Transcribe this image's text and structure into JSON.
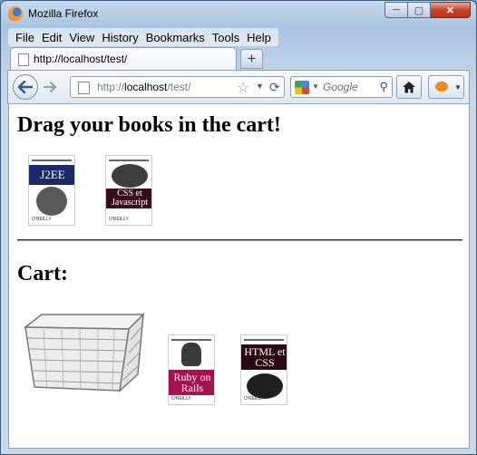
{
  "window": {
    "title": "Mozilla Firefox",
    "buttons": {
      "minimize": "─",
      "maximize": "▢",
      "close": "✕"
    }
  },
  "menubar": {
    "items": [
      "File",
      "Edit",
      "View",
      "History",
      "Bookmarks",
      "Tools",
      "Help"
    ]
  },
  "tab": {
    "label": "http://localhost/test/"
  },
  "newtab": {
    "label": "+"
  },
  "urlbar": {
    "prefix": "http://",
    "host": "localhost",
    "path": "/test/"
  },
  "search": {
    "placeholder": "Google"
  },
  "page": {
    "heading_drag": "Drag your books in the cart!",
    "heading_cart": "Cart:",
    "books": [
      {
        "title": "J2EE",
        "band_color": "#1b2a6b",
        "location": "shelf"
      },
      {
        "title": "CSS et Javascript",
        "band_color": "#3a0d1c",
        "location": "shelf"
      },
      {
        "title": "Ruby on Rails",
        "band_color": "#a3134f",
        "location": "cart"
      },
      {
        "title": "HTML et CSS",
        "band_color": "#2a0a12",
        "location": "cart"
      }
    ]
  },
  "colors": {
    "frame": "#a9c3df",
    "close_button": "#c8452c",
    "content_bg": "#ffffff"
  }
}
